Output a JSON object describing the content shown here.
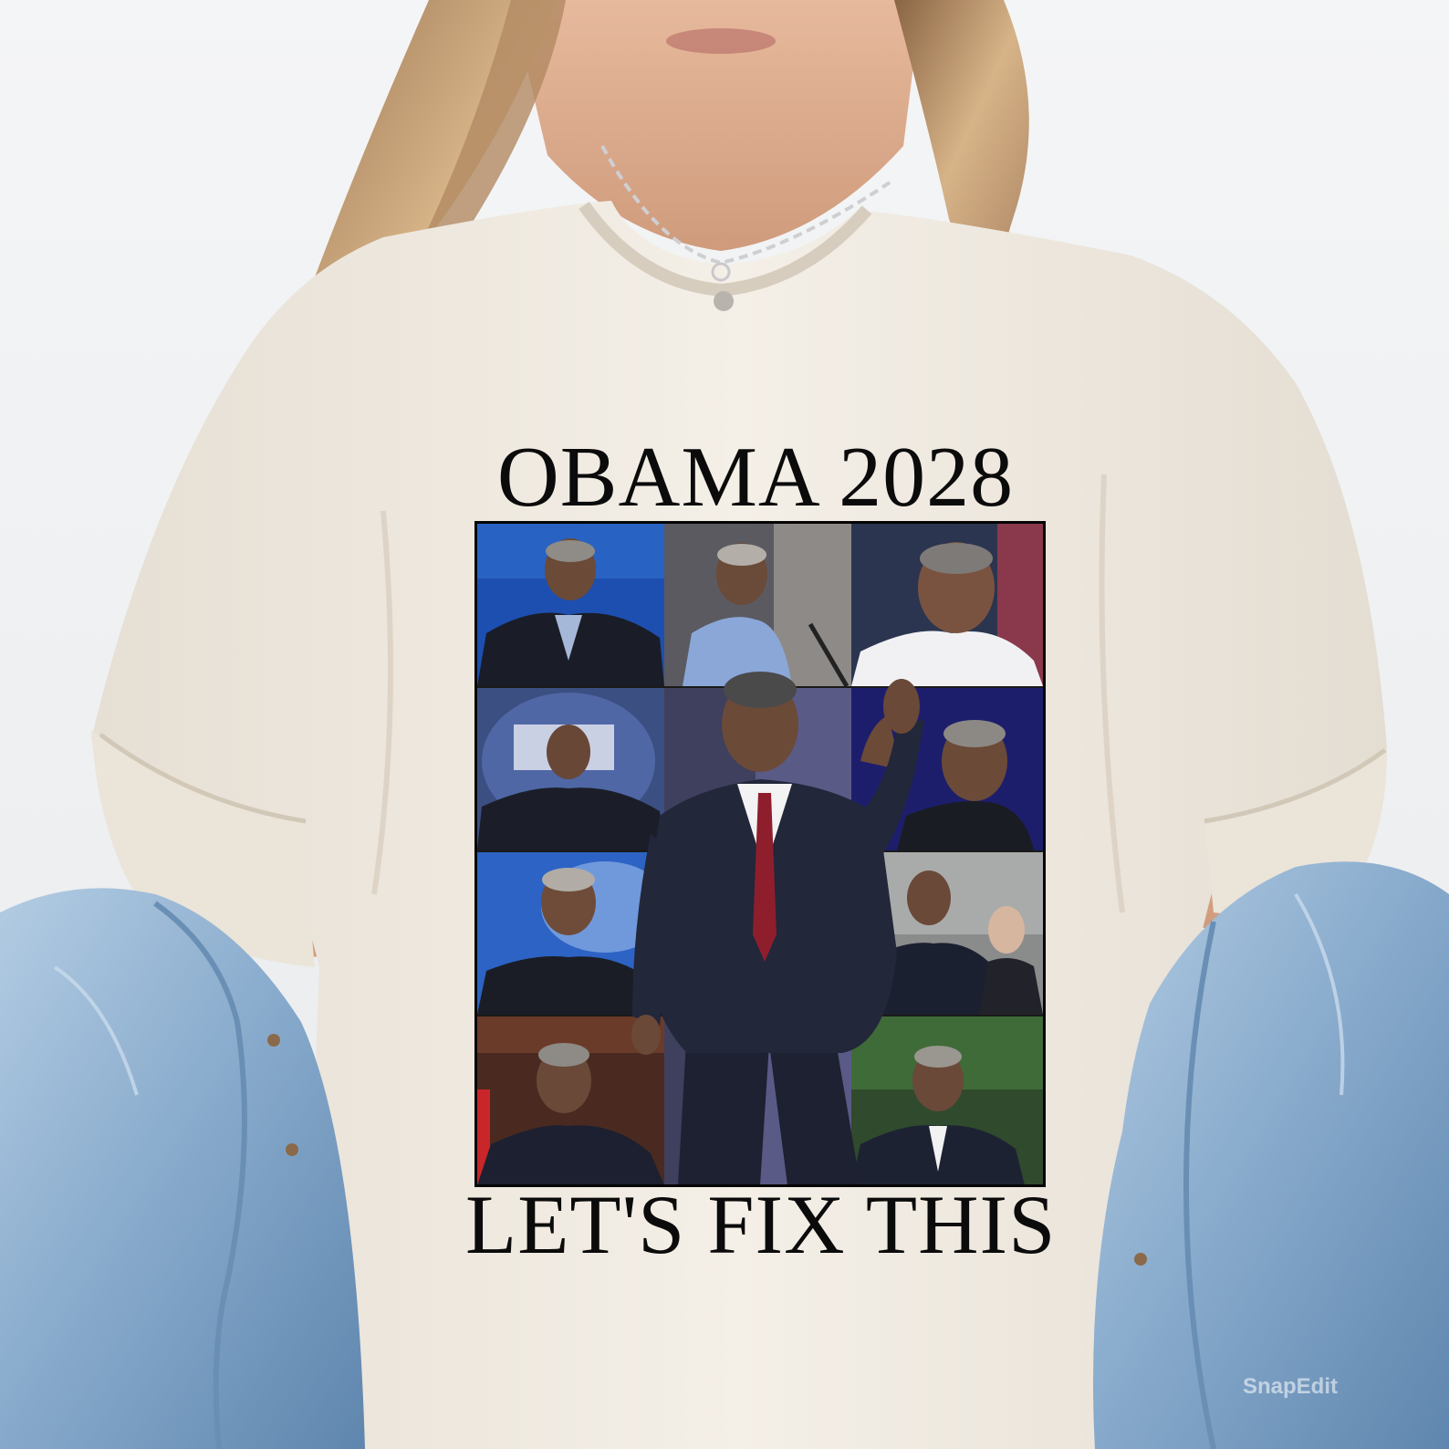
{
  "shirt": {
    "headline": "OBAMA 2028",
    "tagline": "LET'S FIX THIS",
    "color": "#f1ece4",
    "print_color": "#0b0b0b"
  },
  "collage": {
    "photo_count": 13
  },
  "watermark": {
    "text": "SnapEdit"
  },
  "colors": {
    "denim": "#8fb2d3",
    "hair": "#c9a57a",
    "skin": "#d8a889",
    "background": "#eef0f1"
  }
}
